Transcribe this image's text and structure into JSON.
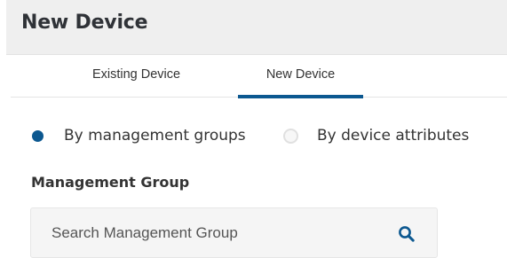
{
  "header": {
    "title": "New Device"
  },
  "tabs": [
    {
      "label": "Existing Device",
      "active": false
    },
    {
      "label": "New Device",
      "active": true
    }
  ],
  "selection_mode": {
    "options": [
      {
        "label": "By management groups",
        "checked": true
      },
      {
        "label": "By device attributes",
        "checked": false
      }
    ]
  },
  "management_group": {
    "label": "Management Group",
    "search_placeholder": "Search Management Group",
    "search_value": ""
  },
  "icons": {
    "search": "search-icon"
  },
  "colors": {
    "accent": "#0c5890",
    "header_bg": "#efefef",
    "input_bg": "#f5f5f5"
  }
}
